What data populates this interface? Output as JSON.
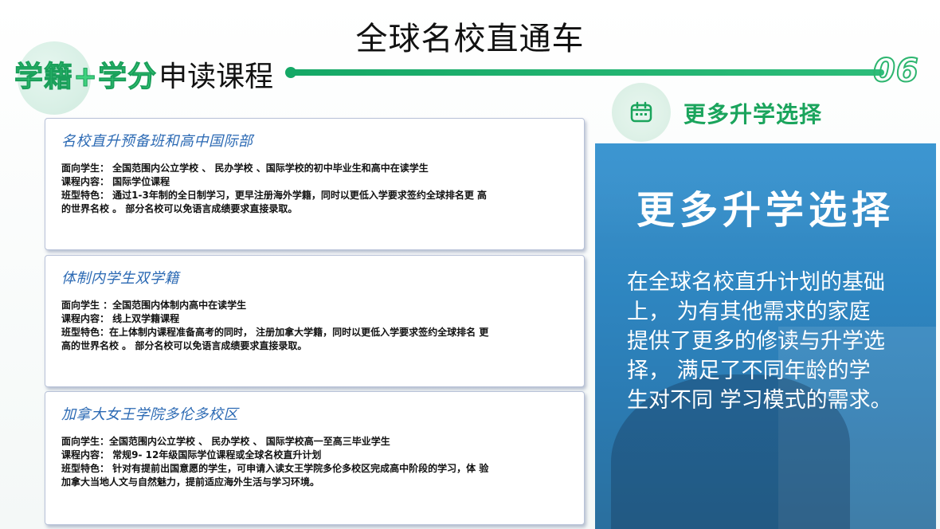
{
  "header": {
    "title": "全球名校直通车",
    "subtitle_highlight": "学籍+学分",
    "subtitle_rest": "申读课程",
    "page_number": "06"
  },
  "colors": {
    "accent_green": "#1aa45c",
    "line_green": "#15a866",
    "card_title_blue": "#2c6ab4",
    "panel_blue": "#2f87c2"
  },
  "cards": [
    {
      "title": "名校直升预备班和高中国际部",
      "lines": [
        "面向学生：  全国范围内公立学校 、 民办学校 、国际学校的初中毕业生和高中在读学生",
        "课程内容：   国际学位课程",
        "班型特色：   通过1-3年制的全日制学习，更早注册海外学籍，同时以更低入学要求签约全球排名更 高",
        "的世界名校 。 部分名校可以免语言成绩要求直接录取。"
      ]
    },
    {
      "title": "体制内学生双学籍",
      "lines": [
        "面向学生 ：全国范围内体制内高中在读学生",
        "课程内容：   线上双学籍课程",
        "班型特色：在上体制内课程准备高考的同时， 注册加拿大学籍，同时以更低入学要求签约全球排名 更",
        "高的世界名校 。 部分名校可以免语言成绩要求直接录取。"
      ]
    },
    {
      "title": "加拿大女王学院多伦多校区",
      "lines": [
        "面向学生：全国范围内公立学校 、 民办学校 、 国际学校高一至高三毕业学生",
        "课程内容：  常规9- 12年级国际学位课程或全球名校直升计划",
        "班型特色： 针对有提前出国意愿的学生，可申请入读女王学院多伦多校区完成高中阶段的学习，体 验",
        "加拿大当地人文与自然魅力，提前适应海外生活与学习环境。"
      ]
    }
  ],
  "right": {
    "icon": "calendar-icon",
    "head_title": "更多升学选择",
    "panel_title": "更多升学选择",
    "panel_body": "在全球名校直升计划的基础\n上，   为有其他需求的家庭\n提供了更多的修读与升学选\n择，   满足了不同年龄的学\n生对不同  学习模式的需求。"
  }
}
